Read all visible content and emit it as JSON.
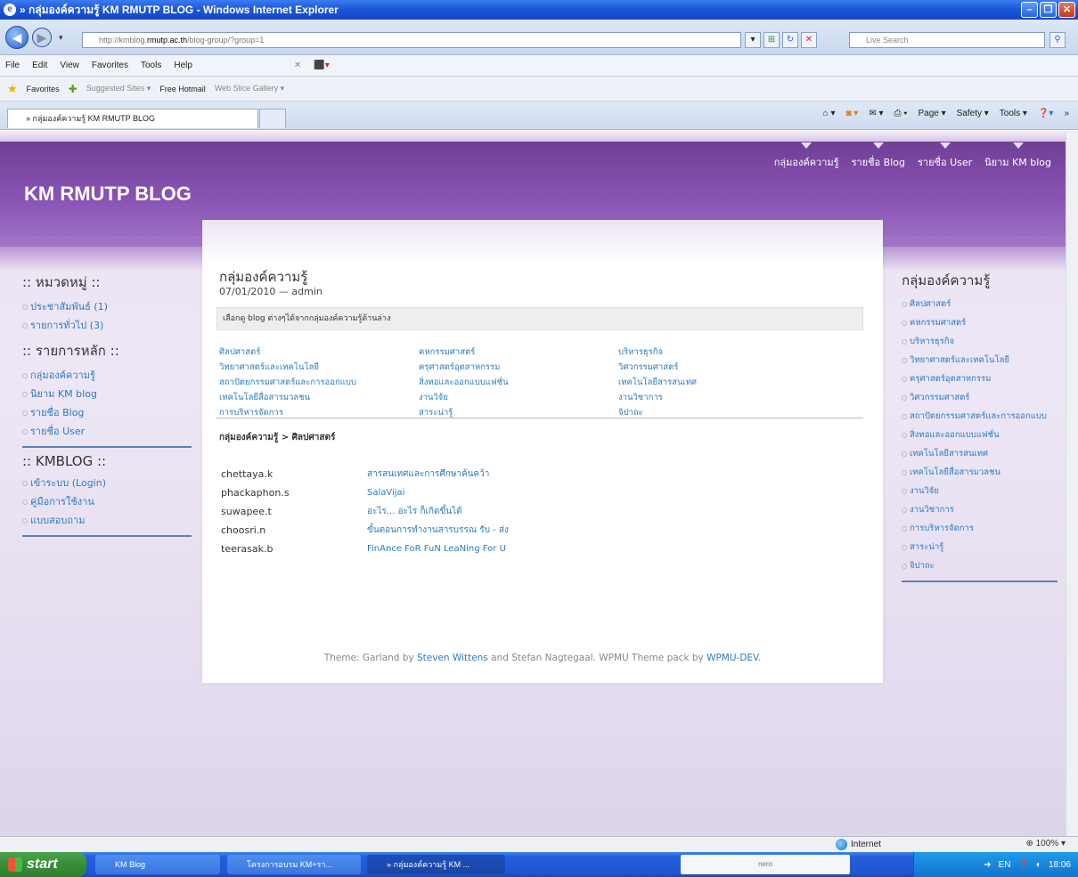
{
  "browser": {
    "title": "» กลุ่มองค์ความรู้ KM RMUTP BLOG - Windows Internet Explorer",
    "url_prefix": "http://kmblog.",
    "url_domain": "rmutp.ac.th",
    "url_path": "/blog-group/?group=1",
    "search_placeholder": "Live Search",
    "menu": [
      "File",
      "Edit",
      "View",
      "Favorites",
      "Tools",
      "Help"
    ],
    "favorites": {
      "label": "Favorites",
      "items": [
        "Suggested Sites ▾",
        "Free Hotmail",
        "Web Slice Gallery ▾"
      ]
    },
    "tab_title": "» กลุ่มองค์ความรู้ KM RMUTP BLOG",
    "tools": [
      "Page ▾",
      "Safety ▾",
      "Tools ▾"
    ],
    "status_zone": "Internet",
    "zoom": "100%"
  },
  "site": {
    "title": "KM RMUTP BLOG",
    "nav": [
      "กลุ่มองค์ความรู้",
      "รายชื่อ Blog",
      "รายชื่อ User",
      "นิยาม KM blog"
    ]
  },
  "left_sidebar": {
    "categories_title": ":: หมวดหมู่ ::",
    "categories": [
      {
        "label": "ประชาสัมพันธ์",
        "count": "(1)"
      },
      {
        "label": "รายการทั่วไป",
        "count": "(3)"
      }
    ],
    "main_title": ":: รายการหลัก ::",
    "main_items": [
      "กลุ่มองค์ความรู้",
      "นิยาม KM blog",
      "รายชื่อ Blog",
      "รายชื่อ User"
    ],
    "kmblog_title": ":: KMBLOG ::",
    "kmblog_items": [
      "เข้าระบบ (Login)",
      "คู่มือการใช้งาน",
      "แบบสอบถาม"
    ]
  },
  "content": {
    "title": "กลุ่มองค์ความรู้",
    "date": "07/01/2010 — admin",
    "info": "เลือกดู blog ต่างๆได้จากกลุ่มองค์ความรู้ด้านล่าง",
    "categories": [
      "ศิลปศาสตร์",
      "คหกรรมศาสตร์",
      "บริหารธุรกิจ",
      "วิทยาศาสตร์และเทคโนโลยี",
      "ครุศาสตร์อุตสาหกรรม",
      "วิศวกรรมศาสตร์",
      "สถาปัตยกรรมศาสตร์และการออกแบบ",
      "สิ่งทอและออกแบบแฟชั่น",
      "เทคโนโลยีสารสนเทศ",
      "เทคโนโลยีสื่อสารมวลชน",
      "งานวิจัย",
      "งานวิชาการ",
      "การบริหารจัดการ",
      "สาระน่ารู้",
      "จิปาถะ"
    ],
    "breadcrumb": "กลุ่มองค์ความรู้ > ศิลปศาสตร์",
    "blogs": [
      {
        "user": "chettaya.k",
        "title": "สารสนเทศและการศึกษาค้นคว้า"
      },
      {
        "user": "phackaphon.s",
        "title": "SalaVijai"
      },
      {
        "user": "suwapee.t",
        "title": "อะไร... อะไร ก็เกิดขึ้นได้"
      },
      {
        "user": "choosri.n",
        "title": "ขั้นตอนการทำงานสารบรรณ รับ - ส่ง"
      },
      {
        "user": "teerasak.b",
        "title": "FinAnce FoR FuN LeaNing For U"
      }
    ],
    "footer_pre": "Theme: Garland by ",
    "footer_link1": "Steven Wittens",
    "footer_mid": " and Stefan Nagtegaal. WPMU Theme pack by ",
    "footer_link2": "WPMU-DEV",
    "footer_post": "."
  },
  "right_sidebar": {
    "title": "กลุ่มองค์ความรู้",
    "items": [
      "ศิลปศาสตร์",
      "คหกรรมศาสตร์",
      "บริหารธุรกิจ",
      "วิทยาศาสตร์และเทคโนโลยี",
      "ครุศาสตร์อุตสาหกรรม",
      "วิศวกรรมศาสตร์",
      "สถาปัตยกรรมศาสตร์และการออกแบบ",
      "สิ่งทอและออกแบบแฟชั่น",
      "เทคโนโลยีสารสนเทศ",
      "เทคโนโลยีสื่อสารมวลชน",
      "งานวิจัย",
      "งานวิชาการ",
      "การบริหารจัดการ",
      "สาระน่ารู้",
      "จิปาถะ"
    ]
  },
  "taskbar": {
    "start": "start",
    "tasks": [
      "KM Blog",
      "โครงการอบรม KM+รา...",
      "» กลุ่มองค์ความรู้ KM ..."
    ],
    "nero": "nero",
    "lang": "EN",
    "time": "18:06"
  }
}
